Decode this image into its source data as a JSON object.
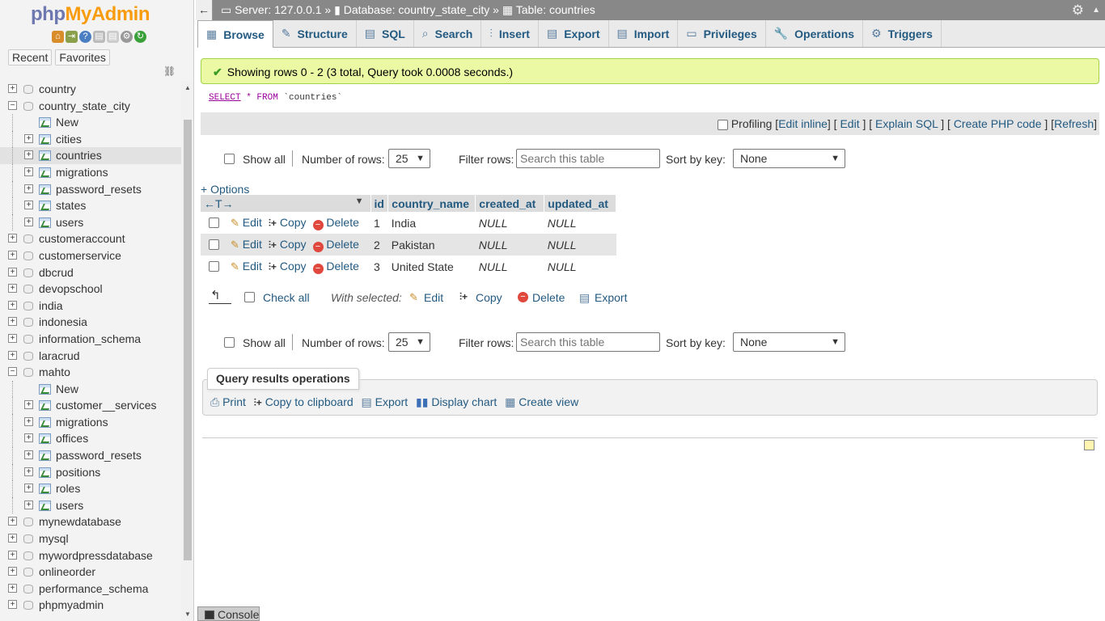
{
  "app": {
    "logo_part1": "php",
    "logo_part2": "MyAdmin"
  },
  "nav": {
    "recent": "Recent",
    "favorites": "Favorites"
  },
  "tree": [
    {
      "label": "country",
      "kind": "db",
      "level": 0,
      "exp": "+"
    },
    {
      "label": "country_state_city",
      "kind": "db",
      "level": 0,
      "exp": "−"
    },
    {
      "label": "New",
      "kind": "new",
      "level": 1
    },
    {
      "label": "cities",
      "kind": "table",
      "level": 1,
      "exp": "+"
    },
    {
      "label": "countries",
      "kind": "table",
      "level": 1,
      "exp": "+",
      "selected": true
    },
    {
      "label": "migrations",
      "kind": "table",
      "level": 1,
      "exp": "+"
    },
    {
      "label": "password_resets",
      "kind": "table",
      "level": 1,
      "exp": "+"
    },
    {
      "label": "states",
      "kind": "table",
      "level": 1,
      "exp": "+"
    },
    {
      "label": "users",
      "kind": "table",
      "level": 1,
      "exp": "+"
    },
    {
      "label": "customeraccount",
      "kind": "db",
      "level": 0,
      "exp": "+"
    },
    {
      "label": "customerservice",
      "kind": "db",
      "level": 0,
      "exp": "+"
    },
    {
      "label": "dbcrud",
      "kind": "db",
      "level": 0,
      "exp": "+"
    },
    {
      "label": "devopschool",
      "kind": "db",
      "level": 0,
      "exp": "+"
    },
    {
      "label": "india",
      "kind": "db",
      "level": 0,
      "exp": "+"
    },
    {
      "label": "indonesia",
      "kind": "db",
      "level": 0,
      "exp": "+"
    },
    {
      "label": "information_schema",
      "kind": "db",
      "level": 0,
      "exp": "+"
    },
    {
      "label": "laracrud",
      "kind": "db",
      "level": 0,
      "exp": "+"
    },
    {
      "label": "mahto",
      "kind": "db",
      "level": 0,
      "exp": "−"
    },
    {
      "label": "New",
      "kind": "new",
      "level": 1
    },
    {
      "label": "customer__services",
      "kind": "table",
      "level": 1,
      "exp": "+"
    },
    {
      "label": "migrations",
      "kind": "table",
      "level": 1,
      "exp": "+"
    },
    {
      "label": "offices",
      "kind": "table",
      "level": 1,
      "exp": "+"
    },
    {
      "label": "password_resets",
      "kind": "table",
      "level": 1,
      "exp": "+"
    },
    {
      "label": "positions",
      "kind": "table",
      "level": 1,
      "exp": "+"
    },
    {
      "label": "roles",
      "kind": "table",
      "level": 1,
      "exp": "+"
    },
    {
      "label": "users",
      "kind": "table",
      "level": 1,
      "exp": "+"
    },
    {
      "label": "mynewdatabase",
      "kind": "db",
      "level": 0,
      "exp": "+"
    },
    {
      "label": "mysql",
      "kind": "db",
      "level": 0,
      "exp": "+"
    },
    {
      "label": "mywordpressdatabase",
      "kind": "db",
      "level": 0,
      "exp": "+"
    },
    {
      "label": "onlineorder",
      "kind": "db",
      "level": 0,
      "exp": "+"
    },
    {
      "label": "performance_schema",
      "kind": "db",
      "level": 0,
      "exp": "+"
    },
    {
      "label": "phpmyadmin",
      "kind": "db",
      "level": 0,
      "exp": "+"
    }
  ],
  "breadcrumb": {
    "server": "Server: 127.0.0.1",
    "database": "Database: country_state_city",
    "table": "Table: countries",
    "sep": "»"
  },
  "tabs": [
    {
      "label": "Browse",
      "active": true,
      "icon": "browse-icon"
    },
    {
      "label": "Structure",
      "icon": "structure-icon"
    },
    {
      "label": "SQL",
      "icon": "sql-icon"
    },
    {
      "label": "Search",
      "icon": "search-icon"
    },
    {
      "label": "Insert",
      "icon": "insert-icon"
    },
    {
      "label": "Export",
      "icon": "export-icon"
    },
    {
      "label": "Import",
      "icon": "import-icon"
    },
    {
      "label": "Privileges",
      "icon": "privileges-icon"
    },
    {
      "label": "Operations",
      "icon": "operations-icon"
    },
    {
      "label": "Triggers",
      "icon": "triggers-icon"
    }
  ],
  "message": {
    "text": "Showing rows 0 - 2 (3 total, Query took 0.0008 seconds.)"
  },
  "sql": {
    "select": "SELECT",
    "rest": " * FROM ",
    "table": "`countries`"
  },
  "sqlbar": {
    "profiling": "Profiling",
    "edit_inline": "Edit inline",
    "edit": "Edit",
    "explain": "Explain SQL",
    "php": "Create PHP code",
    "refresh": "Refresh"
  },
  "navctrl": {
    "show_all": "Show all",
    "number_of_rows": "Number of rows:",
    "rows_value": "25",
    "filter_rows": "Filter rows:",
    "filter_placeholder": "Search this table",
    "sort_by_key": "Sort by key:",
    "sort_value": "None"
  },
  "options_link": "+ Options",
  "table": {
    "columns": [
      "id",
      "country_name",
      "created_at",
      "updated_at"
    ],
    "rows": [
      {
        "id": "1",
        "country_name": "India",
        "created_at": "NULL",
        "updated_at": "NULL"
      },
      {
        "id": "2",
        "country_name": "Pakistan",
        "created_at": "NULL",
        "updated_at": "NULL"
      },
      {
        "id": "3",
        "country_name": "United State",
        "created_at": "NULL",
        "updated_at": "NULL"
      }
    ],
    "actions": {
      "edit": "Edit",
      "copy": "Copy",
      "delete": "Delete"
    }
  },
  "withsel": {
    "check_all": "Check all",
    "with_selected": "With selected:",
    "edit": "Edit",
    "copy": "Copy",
    "delete": "Delete",
    "export": "Export"
  },
  "qro": {
    "title": "Query results operations",
    "print": "Print",
    "copy": "Copy to clipboard",
    "export": "Export",
    "chart": "Display chart",
    "view": "Create view"
  },
  "console": "Console"
}
